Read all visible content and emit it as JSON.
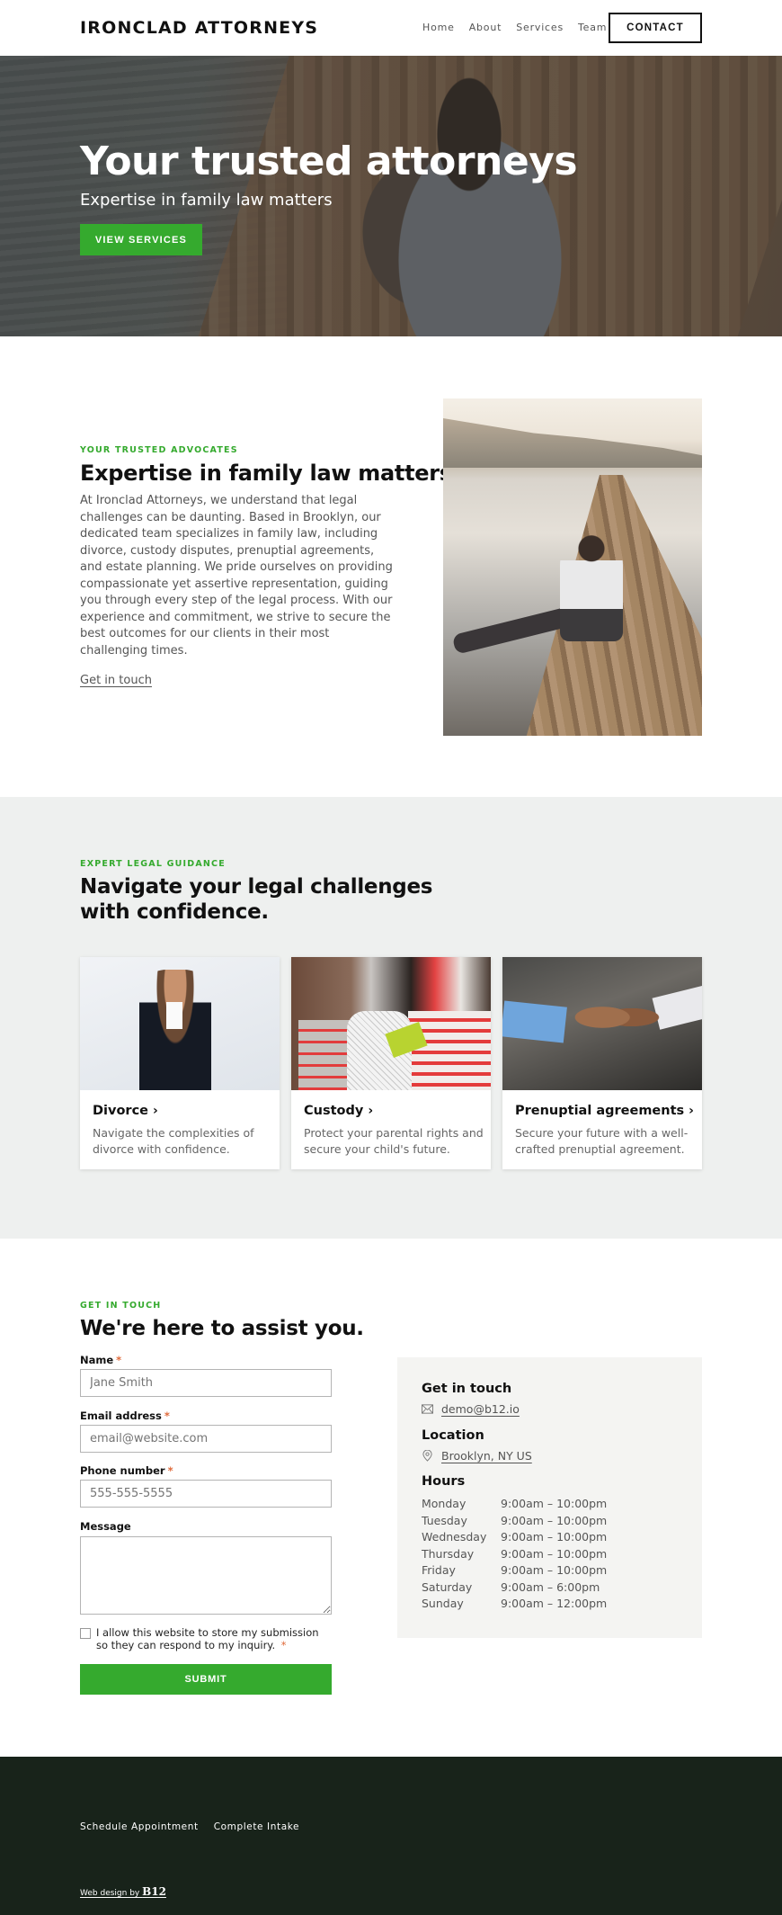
{
  "header": {
    "logo": "IRONCLAD ATTORNEYS",
    "nav": [
      "Home",
      "About",
      "Services",
      "Team"
    ],
    "contact_label": "CONTACT"
  },
  "hero": {
    "title": "Your trusted attorneys",
    "subtitle": "Expertise in family law matters",
    "button_label": "VIEW SERVICES"
  },
  "about": {
    "eyebrow": "YOUR TRUSTED ADVOCATES",
    "title": "Expertise in family law matters",
    "body": "At Ironclad Attorneys, we understand that legal challenges can be daunting. Based in Brooklyn, our dedicated team specializes in family law, including divorce, custody disputes, prenuptial agreements, and estate planning. We pride ourselves on providing compassionate yet assertive representation, guiding you through every step of the legal process. With our experience and commitment, we strive to secure the best outcomes for our clients in their most challenging times.",
    "link_label": "Get in touch"
  },
  "services": {
    "eyebrow": "EXPERT LEGAL GUIDANCE",
    "title": "Navigate your legal challenges with confidence.",
    "cards": [
      {
        "title": "Divorce",
        "description": "Navigate the complexities of divorce with confidence."
      },
      {
        "title": "Custody",
        "description": "Protect your parental rights and secure your child's future."
      },
      {
        "title": "Prenuptial agreements",
        "description": "Secure your future with a well-crafted prenuptial agreement."
      }
    ]
  },
  "contact": {
    "eyebrow": "GET IN TOUCH",
    "title": "We're here to assist you.",
    "fields": {
      "name_label": "Name",
      "name_placeholder": "Jane Smith",
      "email_label": "Email address",
      "email_placeholder": "email@website.com",
      "phone_label": "Phone number",
      "phone_placeholder": "555-555-5555",
      "message_label": "Message"
    },
    "required_mark": "*",
    "consent_text": "I allow this website to store my submission so they can respond to my inquiry.",
    "submit_label": "SUBMIT",
    "info": {
      "touch_heading": "Get in touch",
      "email": "demo@b12.io",
      "location_heading": "Location",
      "location": "Brooklyn, NY US",
      "hours_heading": "Hours",
      "hours": [
        {
          "day": "Monday",
          "time": "9:00am  –  10:00pm"
        },
        {
          "day": "Tuesday",
          "time": "9:00am  –  10:00pm"
        },
        {
          "day": "Wednesday",
          "time": "9:00am  –  10:00pm"
        },
        {
          "day": "Thursday",
          "time": "9:00am  –  10:00pm"
        },
        {
          "day": "Friday",
          "time": "9:00am  –  10:00pm"
        },
        {
          "day": "Saturday",
          "time": "9:00am  –  6:00pm"
        },
        {
          "day": "Sunday",
          "time": "9:00am  –  12:00pm"
        }
      ]
    }
  },
  "footer": {
    "links": [
      "Schedule Appointment",
      "Complete Intake"
    ],
    "credit_prefix": "Web design by ",
    "credit_brand": "B12"
  },
  "colors": {
    "accent_green": "#35aa2e",
    "footer_bg": "#18231a",
    "section_gray": "#eef0ef",
    "required_orange": "#e06a3a"
  }
}
